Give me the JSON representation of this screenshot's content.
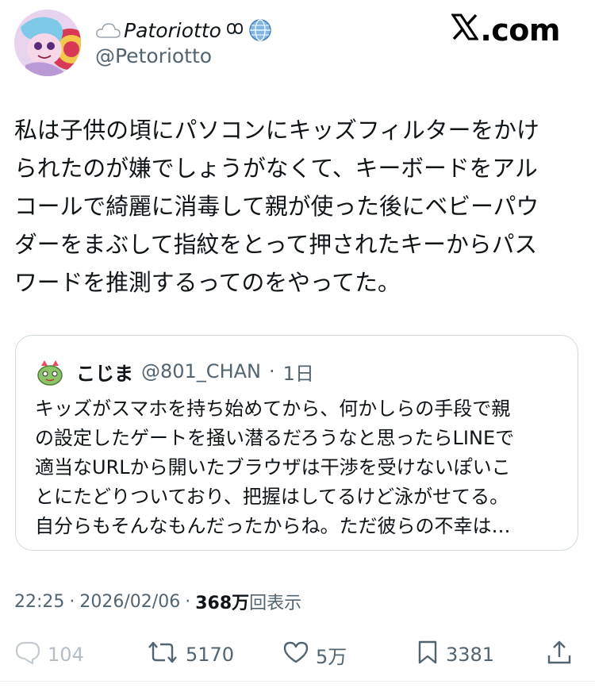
{
  "author": {
    "display_name": "Patoriotto",
    "handle": "@Petoriotto",
    "name_badges": [
      "cloud-emoji",
      "globe-emoji"
    ]
  },
  "brand": {
    "label": ".com"
  },
  "tweet": {
    "text_lines": [
      "私は子供の頃にパソコンにキッズフィルターをかけ",
      "られたのが嫌でしょうがなくて、キーボードをアル",
      "コールで綺麗に消毒して親が使った後にベビーパウ",
      "ダーをまぶして指紋をとって押されたキーからパス",
      "ワードを推測するってのをやってた。"
    ]
  },
  "quote": {
    "display_name": "こじま",
    "handle": "@801_CHAN",
    "separator": "·",
    "age": "1日",
    "text_lines": [
      "キッズがスマホを持ち始めてから、何かしらの手段で親",
      "の設定したゲートを掻い潜るだろうなと思ったらLINEで",
      "適当なURLから開いたブラウザは干渉を受けないぽいこ",
      "とにたどりついており、把握はしてるけど泳がせてる。",
      "自分らもそんなもんだったからね。ただ彼らの不幸は…"
    ]
  },
  "meta": {
    "time": "22:25",
    "separator": "·",
    "date": "2026/02/06",
    "separator2": "·",
    "views_count": "368万",
    "views_label": "回表示"
  },
  "actions": {
    "reply_count": "104",
    "retweet_count": "5170",
    "like_count": "5万",
    "bookmark_count": "3381"
  },
  "colors": {
    "text": "#0f1419",
    "secondary": "#536471",
    "border": "#cfd9de"
  }
}
